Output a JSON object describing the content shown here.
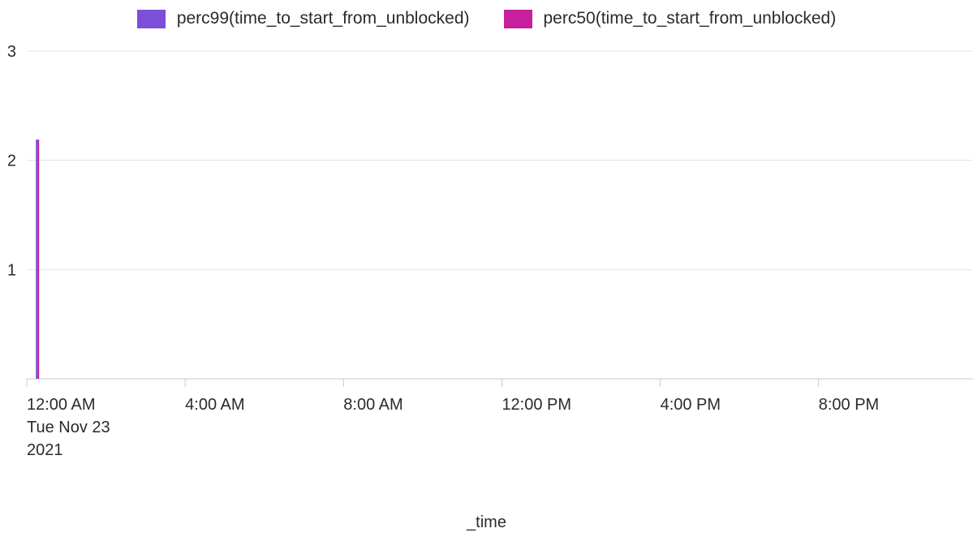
{
  "chart_data": {
    "type": "bar",
    "xlabel": "_time",
    "ylabel": "",
    "ylim": [
      0,
      3
    ],
    "y_ticks": [
      "1",
      "2",
      "3"
    ],
    "x_ticks": [
      {
        "lines": [
          "12:00 AM",
          "Tue Nov 23",
          "2021"
        ]
      },
      {
        "lines": [
          "4:00 AM"
        ]
      },
      {
        "lines": [
          "8:00 AM"
        ]
      },
      {
        "lines": [
          "12:00 PM"
        ]
      },
      {
        "lines": [
          "4:00 PM"
        ]
      },
      {
        "lines": [
          "8:00 PM"
        ]
      }
    ],
    "x_tick_hours": [
      0,
      4,
      8,
      12,
      16,
      20
    ],
    "x_range_hours": [
      0,
      23.9
    ],
    "grid": true,
    "legend_position": "top-center",
    "series": [
      {
        "name": "perc99(time_to_start_from_unblocked)",
        "color": "#7b4fd6",
        "points": [
          {
            "x": "2021-11-23 00:15",
            "x_hours": 0.25,
            "y": 2.19
          }
        ]
      },
      {
        "name": "perc50(time_to_start_from_unblocked)",
        "color": "#c71f9e",
        "points": [
          {
            "x": "2021-11-23 00:15",
            "x_hours": 0.25,
            "y": 2.19
          }
        ]
      }
    ]
  }
}
